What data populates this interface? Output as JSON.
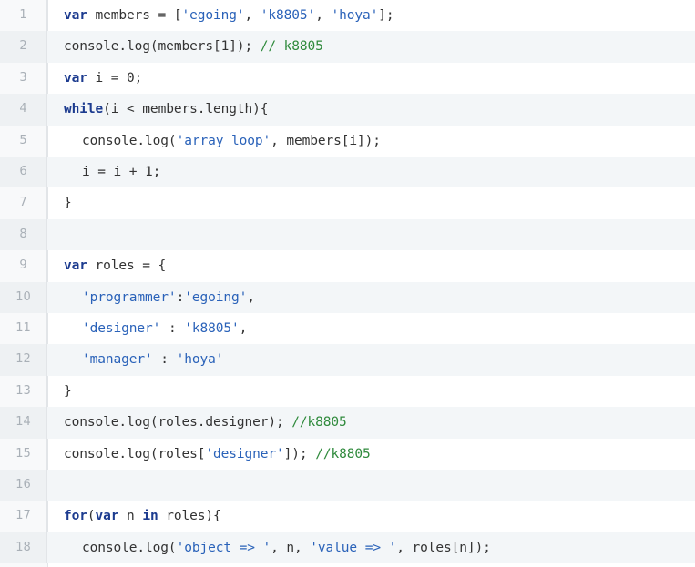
{
  "colors": {
    "background": "#ffffff",
    "alt_row": "#f3f6f8",
    "gutter": "#f8f9fa",
    "line_number": "#a9b0b7",
    "keyword": "#1c3b8f",
    "string": "#2a62b9",
    "comment": "#2f8a3c",
    "plain": "#333333"
  },
  "lines": [
    {
      "n": "1",
      "indent": 0,
      "tokens": [
        {
          "t": "var",
          "k": "kw"
        },
        {
          "t": " members = [",
          "k": "pl"
        },
        {
          "t": "'egoing'",
          "k": "str"
        },
        {
          "t": ", ",
          "k": "pl"
        },
        {
          "t": "'k8805'",
          "k": "str"
        },
        {
          "t": ", ",
          "k": "pl"
        },
        {
          "t": "'hoya'",
          "k": "str"
        },
        {
          "t": "];",
          "k": "pl"
        }
      ]
    },
    {
      "n": "2",
      "indent": 0,
      "tokens": [
        {
          "t": "console.log(members[1]); ",
          "k": "pl"
        },
        {
          "t": "// k8805",
          "k": "cmt"
        }
      ]
    },
    {
      "n": "3",
      "indent": 0,
      "tokens": [
        {
          "t": "var",
          "k": "kw"
        },
        {
          "t": " i = 0;",
          "k": "pl"
        }
      ]
    },
    {
      "n": "4",
      "indent": 0,
      "tokens": [
        {
          "t": "while",
          "k": "kw"
        },
        {
          "t": "(i < members.length){",
          "k": "pl"
        }
      ]
    },
    {
      "n": "5",
      "indent": 1,
      "tokens": [
        {
          "t": "console.log(",
          "k": "pl"
        },
        {
          "t": "'array loop'",
          "k": "str"
        },
        {
          "t": ", members[i]);",
          "k": "pl"
        }
      ]
    },
    {
      "n": "6",
      "indent": 1,
      "tokens": [
        {
          "t": "i = i + 1;",
          "k": "pl"
        }
      ]
    },
    {
      "n": "7",
      "indent": 0,
      "tokens": [
        {
          "t": "}",
          "k": "pl"
        }
      ]
    },
    {
      "n": "8",
      "indent": 0,
      "tokens": []
    },
    {
      "n": "9",
      "indent": 0,
      "tokens": [
        {
          "t": "var",
          "k": "kw"
        },
        {
          "t": " roles = {",
          "k": "pl"
        }
      ]
    },
    {
      "n": "10",
      "indent": 1,
      "tokens": [
        {
          "t": "'programmer'",
          "k": "str"
        },
        {
          "t": ":",
          "k": "pl"
        },
        {
          "t": "'egoing'",
          "k": "str"
        },
        {
          "t": ",",
          "k": "pl"
        }
      ]
    },
    {
      "n": "11",
      "indent": 1,
      "tokens": [
        {
          "t": "'designer'",
          "k": "str"
        },
        {
          "t": " : ",
          "k": "pl"
        },
        {
          "t": "'k8805'",
          "k": "str"
        },
        {
          "t": ",",
          "k": "pl"
        }
      ]
    },
    {
      "n": "12",
      "indent": 1,
      "tokens": [
        {
          "t": "'manager'",
          "k": "str"
        },
        {
          "t": " : ",
          "k": "pl"
        },
        {
          "t": "'hoya'",
          "k": "str"
        }
      ]
    },
    {
      "n": "13",
      "indent": 0,
      "tokens": [
        {
          "t": "}",
          "k": "pl"
        }
      ]
    },
    {
      "n": "14",
      "indent": 0,
      "tokens": [
        {
          "t": "console.log(roles.designer); ",
          "k": "pl"
        },
        {
          "t": "//k8805",
          "k": "cmt"
        }
      ]
    },
    {
      "n": "15",
      "indent": 0,
      "tokens": [
        {
          "t": "console.log(roles[",
          "k": "pl"
        },
        {
          "t": "'designer'",
          "k": "str"
        },
        {
          "t": "]); ",
          "k": "pl"
        },
        {
          "t": "//k8805",
          "k": "cmt"
        }
      ]
    },
    {
      "n": "16",
      "indent": 0,
      "tokens": []
    },
    {
      "n": "17",
      "indent": 0,
      "tokens": [
        {
          "t": "for",
          "k": "kw"
        },
        {
          "t": "(",
          "k": "pl"
        },
        {
          "t": "var",
          "k": "kw"
        },
        {
          "t": " n ",
          "k": "pl"
        },
        {
          "t": "in",
          "k": "kw"
        },
        {
          "t": " roles){",
          "k": "pl"
        }
      ]
    },
    {
      "n": "18",
      "indent": 1,
      "tokens": [
        {
          "t": "console.log(",
          "k": "pl"
        },
        {
          "t": "'object => '",
          "k": "str"
        },
        {
          "t": ", n, ",
          "k": "pl"
        },
        {
          "t": "'value => '",
          "k": "str"
        },
        {
          "t": ", roles[n]);",
          "k": "pl"
        }
      ]
    }
  ]
}
